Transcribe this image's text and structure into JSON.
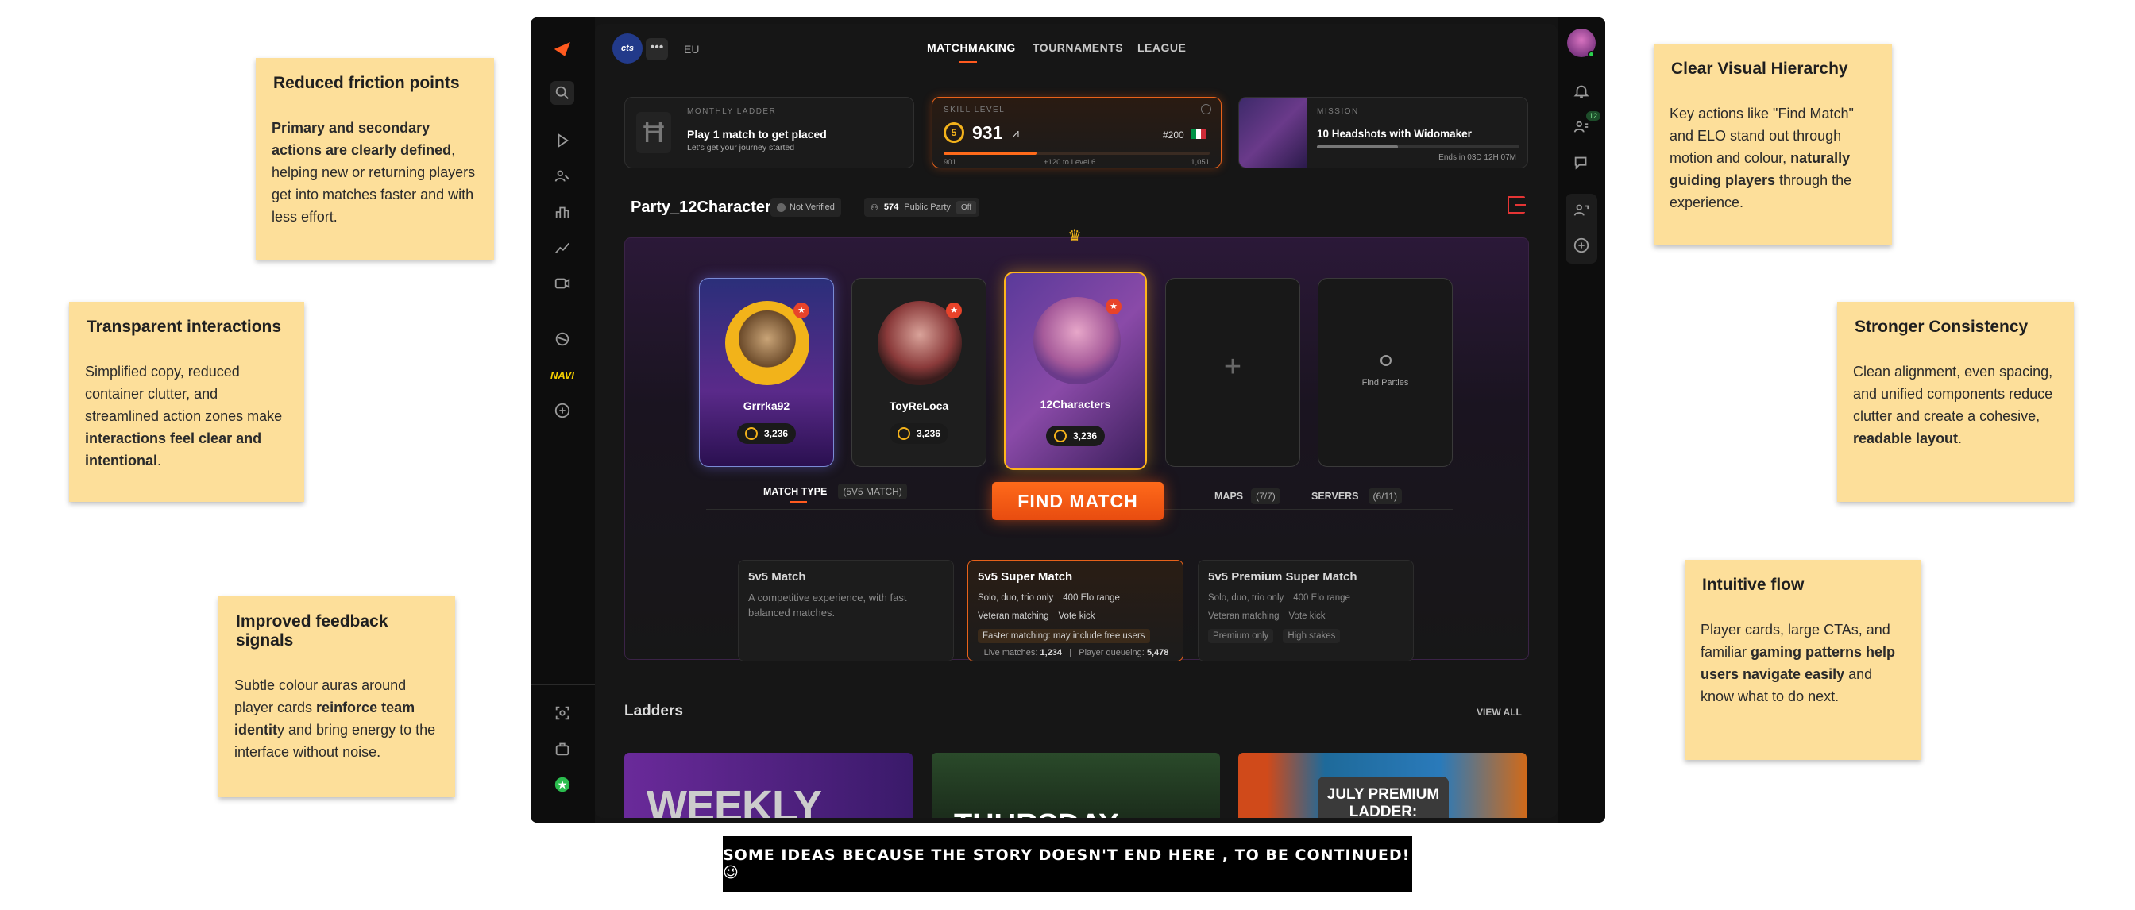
{
  "notes": {
    "friction": {
      "title": "Reduced friction points",
      "b1": "Primary and secondary actions are clearly defined",
      "t1": ", helping new or returning players get into matches faster and with less effort."
    },
    "transparent": {
      "title": "Transparent interactions",
      "t1": "Simplified copy, reduced container clutter, and streamlined action zones make ",
      "b1": "interactions feel clear and intentional",
      "t2": "."
    },
    "feedback": {
      "title": "Improved feedback signals",
      "t1": "Subtle colour auras around player cards ",
      "b1": "reinforce team identit",
      "t2": "y and bring energy to the interface without noise."
    },
    "hierarchy": {
      "title": "Clear Visual Hierarchy",
      "t1": "Key actions like \"Find Match\" and ELO stand out through motion and colour, ",
      "b1": "naturally guiding players",
      "t2": " through the experience."
    },
    "consistency": {
      "title": "Stronger Consistency",
      "t1": "Clean alignment, even spacing, and unified components reduce clutter and create a cohesive, ",
      "b1": "readable layout",
      "t2": "."
    },
    "flow": {
      "title": "Intuitive flow",
      "t1": "Player cards, large CTAs, and familiar ",
      "b1": "gaming patterns help users navigate easily",
      "t2": " and know what to do next."
    }
  },
  "footer": "SOME IDEAS BECAUSE THE STORY DOESN'T END HERE , TO BE CONTINUED! 😉",
  "topbar": {
    "logo": "cts",
    "region": "EU",
    "tabs": [
      "MATCHMAKING",
      "TOURNAMENTS",
      "LEAGUE"
    ]
  },
  "ladder_card": {
    "label": "MONTHLY LADDER",
    "title": "Play 1 match to get placed",
    "sub": "Let's get your journey started"
  },
  "skill_card": {
    "label": "SKILL LEVEL",
    "elo": "931",
    "rank": "#200",
    "min": "901",
    "mid": "+120 to Level 6",
    "max": "1,051",
    "progress": 0.35
  },
  "mission_card": {
    "label": "MISSION",
    "title": "10 Headshots with Widomaker",
    "ends": "Ends in 03D 12H 07M"
  },
  "party": {
    "name": "Party_12Characters",
    "verified": "Not Verified",
    "count": "574",
    "public": "Public Party",
    "toggle": "Off"
  },
  "players": [
    {
      "name": "Grrrka92",
      "elo": "3,236"
    },
    {
      "name": "ToyReLoca",
      "elo": "3,236"
    },
    {
      "name": "12Characters",
      "elo": "3,236"
    }
  ],
  "find_parties": "Find Parties",
  "match_type": {
    "label": "MATCH TYPE",
    "value": "(5V5 MATCH)"
  },
  "find_match": "FIND MATCH",
  "maps": {
    "label": "MAPS",
    "value": "(7/7)"
  },
  "servers": {
    "label": "SERVERS",
    "value": "(6/11)"
  },
  "modes": [
    {
      "title": "5v5 Match",
      "desc": "A competitive experience, with fast balanced matches."
    },
    {
      "title": "5v5 Super Match",
      "f1": "Solo, duo, trio only",
      "f2": "400 Elo range",
      "f3": "Veteran matching",
      "f4": "Vote kick",
      "f5": "Faster matching: may include free users"
    },
    {
      "title": "5v5 Premium Super Match",
      "f1": "Solo, duo, trio only",
      "f2": "400 Elo range",
      "f3": "Veteran matching",
      "f4": "Vote kick",
      "f5": "Premium only",
      "f6": "High stakes"
    }
  ],
  "stats": {
    "live_label": "Live matches:",
    "live": "1,234",
    "queue_label": "Player queueing:",
    "queue": "5,478"
  },
  "ladders": {
    "title": "Ladders",
    "view_all": "VIEW ALL",
    "items": [
      "WEEKLY",
      "THURSDAY",
      "JULY PREMIUM LADDER:"
    ]
  },
  "rside": {
    "badge": "12"
  }
}
